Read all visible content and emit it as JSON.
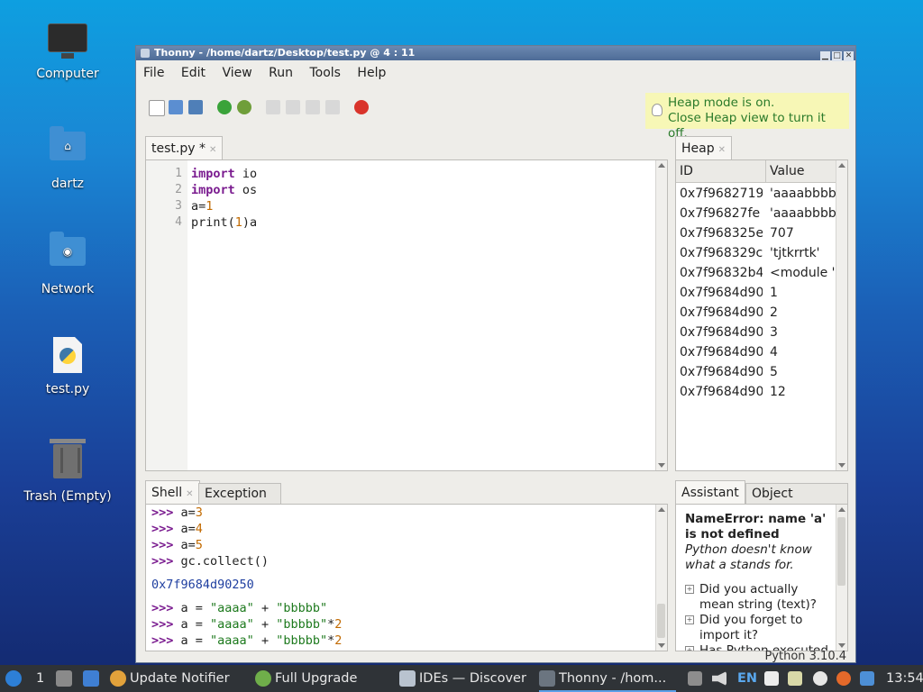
{
  "desktop": {
    "icons": [
      {
        "label": "Computer"
      },
      {
        "label": "dartz"
      },
      {
        "label": "Network"
      },
      {
        "label": "test.py"
      },
      {
        "label": "Trash (Empty)"
      }
    ]
  },
  "window": {
    "title": "Thonny  -  /home/dartz/Desktop/test.py  @  4 : 11",
    "menu": [
      "File",
      "Edit",
      "View",
      "Run",
      "Tools",
      "Help"
    ],
    "heap_note": [
      "Heap mode is on.",
      "Close Heap view to turn it off."
    ]
  },
  "editor": {
    "tab": "test.py *",
    "line_numbers": [
      "1",
      "2",
      "3",
      "4"
    ],
    "lines": [
      {
        "kw": "import",
        "rest": " io"
      },
      {
        "kw": "import",
        "rest": " os"
      },
      {
        "kw": "",
        "rest": "a=",
        "num": "1"
      },
      {
        "kw": "",
        "rest": "print(",
        "num": "1",
        "tail": ")a"
      }
    ]
  },
  "heap": {
    "tab": "Heap",
    "col_id": "ID",
    "col_value": "Value",
    "rows": [
      {
        "id": "0x7f9682719",
        "value": "'aaaabbbbb"
      },
      {
        "id": "0x7f96827fe",
        "value": "'aaaabbbbb"
      },
      {
        "id": "0x7f968325e",
        "value": "707"
      },
      {
        "id": "0x7f968329c",
        "value": "'tjtkrrtk'"
      },
      {
        "id": "0x7f96832b4",
        "value": "<module '"
      },
      {
        "id": "0x7f9684d90",
        "value": "1"
      },
      {
        "id": "0x7f9684d90",
        "value": "2"
      },
      {
        "id": "0x7f9684d90",
        "value": "3"
      },
      {
        "id": "0x7f9684d90",
        "value": "4"
      },
      {
        "id": "0x7f9684d90",
        "value": "5"
      },
      {
        "id": "0x7f9684d90",
        "value": "12"
      }
    ]
  },
  "shell": {
    "tab": "Shell",
    "tab2": "Exception",
    "prompt": ">>>",
    "lines": [
      {
        "type": "cmd",
        "pre": "a=",
        "num": "3"
      },
      {
        "type": "cmd",
        "pre": "a=",
        "num": "4"
      },
      {
        "type": "cmd",
        "pre": "a=",
        "num": "5"
      },
      {
        "type": "cmd",
        "pre": "gc.collect()"
      },
      {
        "type": "out",
        "text": "0x7f9684d90250"
      },
      {
        "type": "cmd",
        "pre": "a = ",
        "s1": "\"aaaa\"",
        "mid": " + ",
        "s2": "\"bbbbb\""
      },
      {
        "type": "cmd",
        "pre": "a = ",
        "s1": "\"aaaa\"",
        "mid": " + ",
        "s2": "\"bbbbb\"",
        "tail": "*",
        "num": "2"
      },
      {
        "type": "cmd",
        "pre": "a = ",
        "s1": "\"aaaa\"",
        "mid": " + ",
        "s2": "\"bbbbb\"",
        "tail": "*",
        "num": "2"
      }
    ]
  },
  "assistant": {
    "tab": "Assistant",
    "tab2": "Object inspecto",
    "error_line1": "NameError: name 'a'",
    "error_line2": "is not defined",
    "hint_line1": "Python doesn't know",
    "hint_line2": "what a stands for.",
    "suggestions": [
      {
        "l1": "Did you actually",
        "l2": "mean string (text)?"
      },
      {
        "l1": "Did you forget to",
        "l2": "import it?"
      },
      {
        "l1": "Has Python executed",
        "l2": ""
      }
    ]
  },
  "status": "Python 3.10.4",
  "taskbar": {
    "workspace": "1",
    "tasks": [
      "Update Notifier",
      "Full Upgrade",
      "IDEs — Discover",
      "Thonny  -  /hom..."
    ],
    "lang": "EN",
    "clock": "13:54"
  },
  "colors": {
    "keyword": "#7a1b8f",
    "number": "#c26a00",
    "string": "#1e7a1e",
    "output": "#1f3fa0"
  }
}
